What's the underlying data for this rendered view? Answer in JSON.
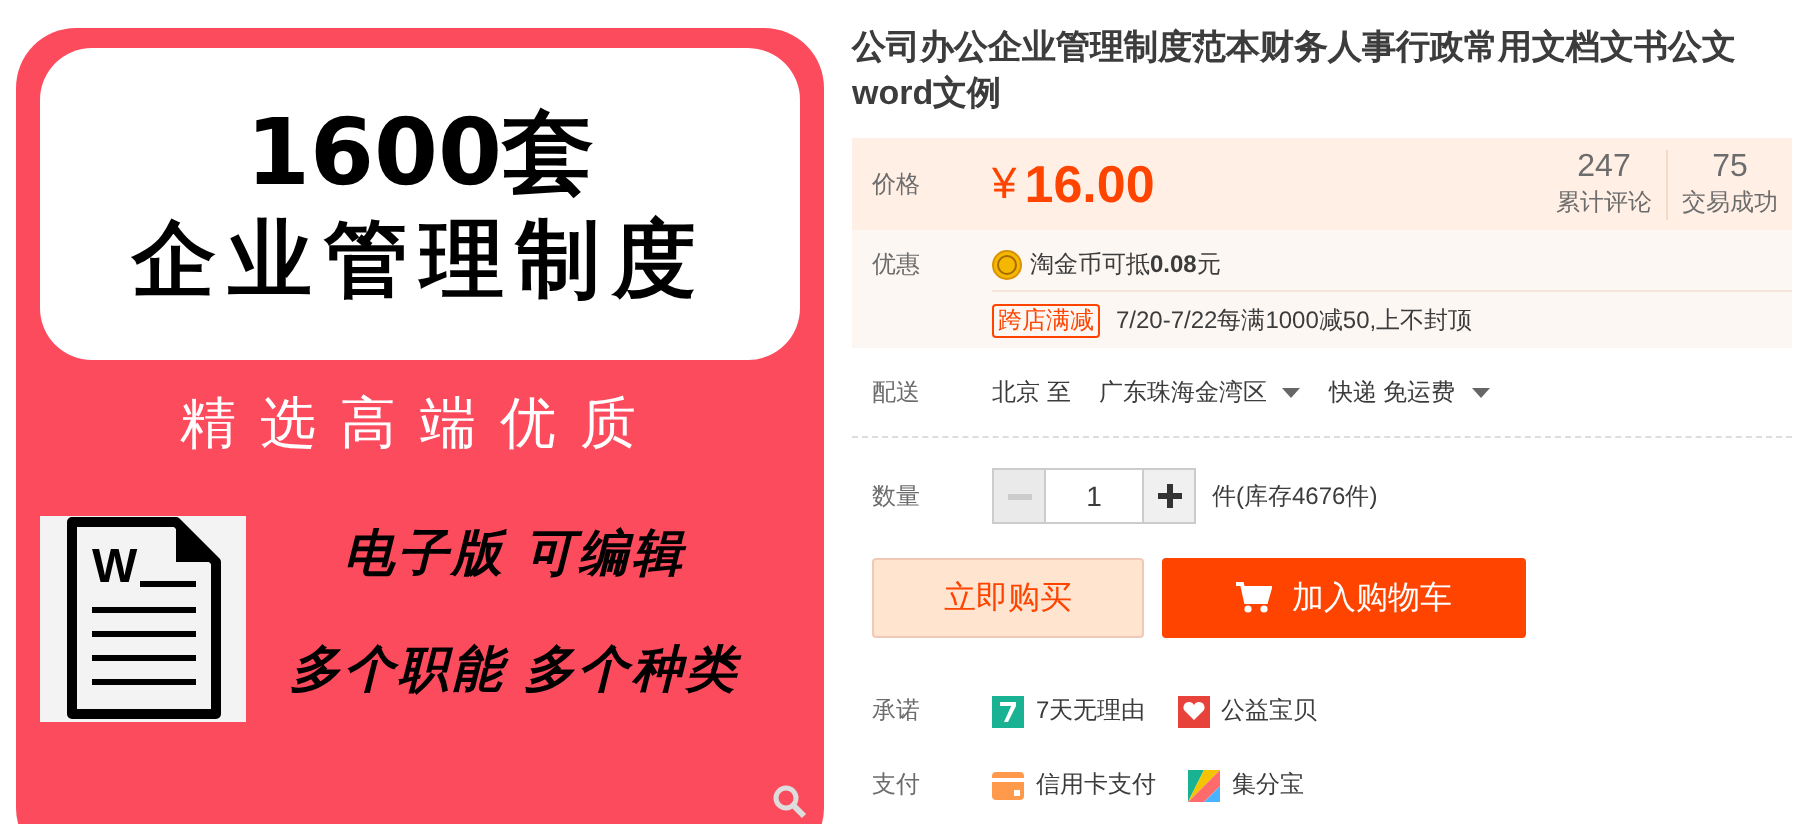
{
  "product_image": {
    "headline": "1600套",
    "subtitle": "企业管理制度",
    "tagline": "精选高端优质",
    "doc_letter": "W",
    "features": [
      "电子版 可编辑",
      "多个职能 多个种类"
    ]
  },
  "title": "公司办公企业管理制度范本财务人事行政常用文档文书公文word文例",
  "price": {
    "label": "价格",
    "currency": "¥",
    "amount": "16.00"
  },
  "stats": [
    {
      "value": "247",
      "label": "累计评论"
    },
    {
      "value": "75",
      "label": "交易成功"
    }
  ],
  "promo": {
    "label": "优惠",
    "coin_text": "淘金币可抵**0.08**元",
    "tag": "跨店满减",
    "tag_text": "7/20-7/22每满1000减50,上不封顶"
  },
  "delivery": {
    "label": "配送",
    "from": "北京 至",
    "to": "广东珠海金湾区",
    "method": "快递 免运费"
  },
  "quantity": {
    "label": "数量",
    "value": "1",
    "stock": "件(库存4676件)",
    "minus_disabled": true
  },
  "buttons": [
    {
      "kind": "buy",
      "label": "立即购买"
    },
    {
      "kind": "cart",
      "label": "加入购物车"
    }
  ],
  "promise": {
    "label": "承诺",
    "items": [
      {
        "kind": "seven",
        "text": "7天无理由"
      },
      {
        "kind": "charity",
        "text": "公益宝贝"
      }
    ]
  },
  "payment": {
    "label": "支付",
    "items": [
      {
        "kind": "card",
        "text": "信用卡支付"
      },
      {
        "kind": "points",
        "text": "集分宝"
      }
    ]
  }
}
